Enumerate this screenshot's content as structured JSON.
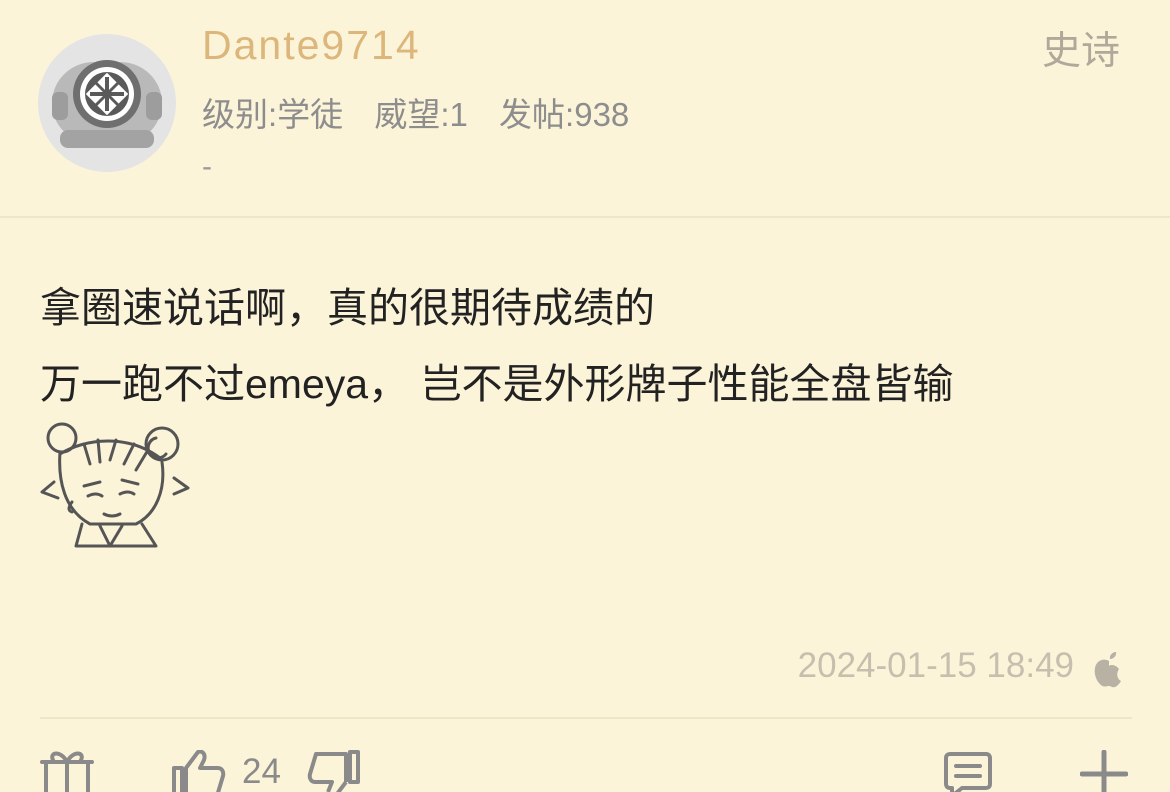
{
  "user": {
    "name": "Dante9714",
    "level": "级别:学徒",
    "prestige": "威望:1",
    "posts": "发帖:938",
    "signature": "-"
  },
  "floor_label": "史诗",
  "post": {
    "line1": "拿圈速说话啊，真的很期待成绩的",
    "line2": "万一跑不过emeya， 岂不是外形牌子性能全盘皆输",
    "time": "2024-01-15 18:49",
    "device_icon": "apple-icon"
  },
  "actions": {
    "gift_icon": "gift-icon",
    "like_icon": "thumbs-up-icon",
    "like_count": "24",
    "dislike_icon": "thumbs-down-icon",
    "comment_icon": "comment-icon",
    "more_icon": "plus-icon"
  },
  "colors": {
    "background": "#fcf4d9",
    "username": "#dcb67a",
    "muted": "#8d8d8d"
  }
}
